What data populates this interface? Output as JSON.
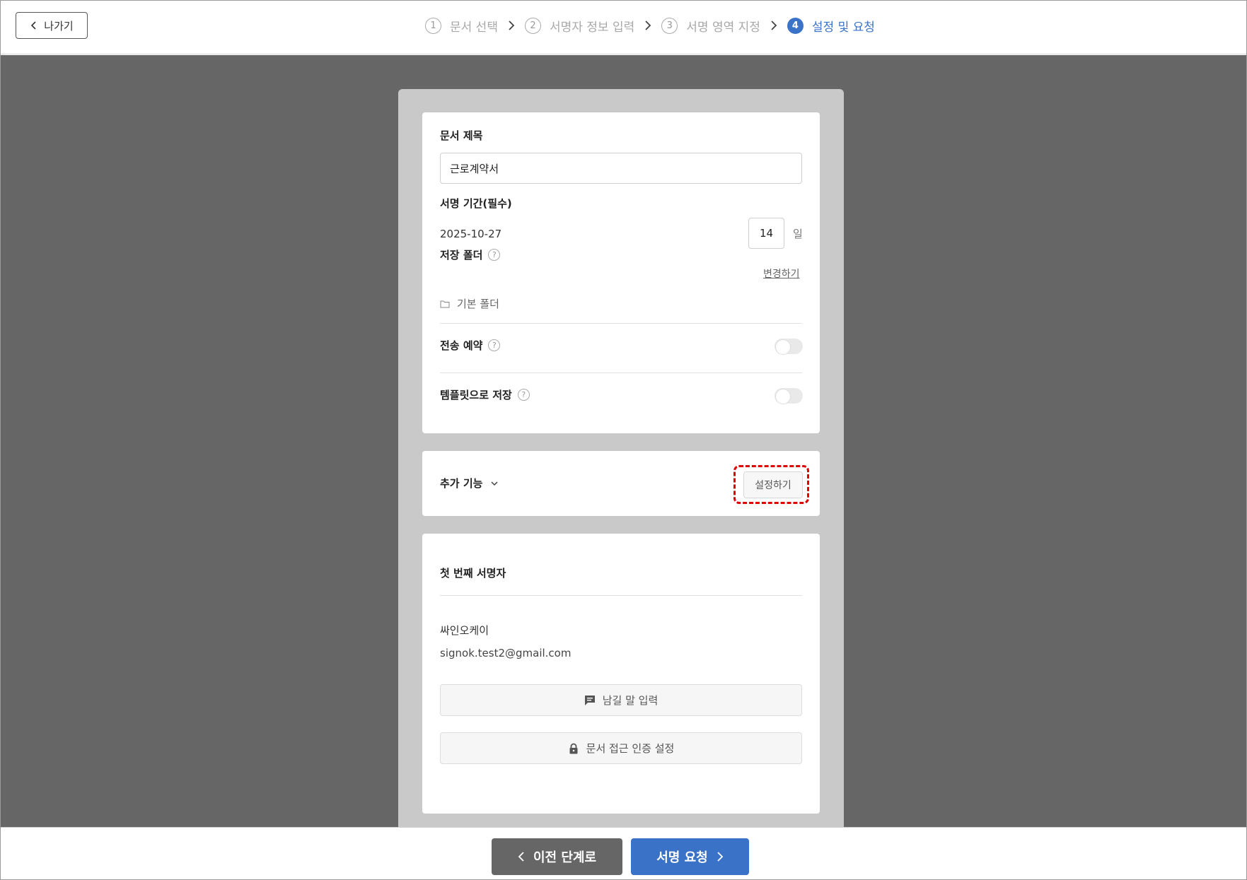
{
  "header": {
    "back_label": "나가기",
    "steps": [
      {
        "num": "1",
        "label": "문서 선택"
      },
      {
        "num": "2",
        "label": "서명자 정보 입력"
      },
      {
        "num": "3",
        "label": "서명 영역 지정"
      },
      {
        "num": "4",
        "label": "설정 및 요청"
      }
    ],
    "active_step": 4
  },
  "settings": {
    "doc_title_label": "문서 제목",
    "doc_title_value": "근로계약서",
    "period_label": "서명 기간(필수)",
    "period_date": "2025-10-27",
    "period_days": "14",
    "period_unit": "일",
    "folder_label": "저장 폴더",
    "folder_change": "변경하기",
    "folder_value": "기본 폴더",
    "schedule_label": "전송 예약",
    "schedule_on": false,
    "template_label": "템플릿으로 저장",
    "template_on": false
  },
  "extra": {
    "label": "추가 기능",
    "button": "설정하기"
  },
  "signer": {
    "heading": "첫 번째 서명자",
    "name": "싸인오케이",
    "email": "signok.test2@gmail.com",
    "message_button": "남길 말 입력",
    "auth_button": "문서 접근 인증 설정"
  },
  "footer": {
    "prev_label": "이전 단계로",
    "request_label": "서명 요청"
  },
  "colors": {
    "accent": "#3a72c8",
    "highlight": "#e00000",
    "backdrop": "#666666"
  }
}
